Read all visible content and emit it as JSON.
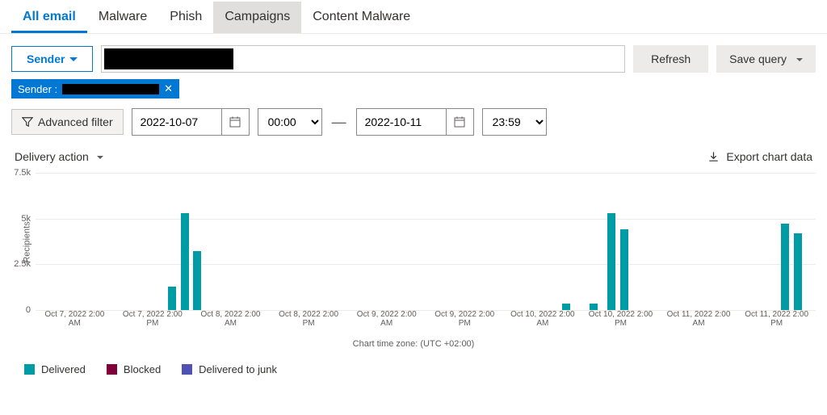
{
  "tabs": [
    "All email",
    "Malware",
    "Phish",
    "Campaigns",
    "Content Malware"
  ],
  "active_tab": 0,
  "muted_tab": 3,
  "filter": {
    "sender_label": "Sender",
    "search_value": "",
    "refresh_label": "Refresh",
    "save_query_label": "Save query"
  },
  "chip": {
    "label": "Sender :",
    "remove": "✕"
  },
  "adv_filter_label": "Advanced filter",
  "date": {
    "start": "2022-10-07",
    "start_time": "00:00",
    "end": "2022-10-11",
    "end_time": "23:59"
  },
  "view_label": "Delivery action",
  "export_label": "Export chart data",
  "chart_data": {
    "type": "bar",
    "ylabel": "Recipients",
    "ylim": [
      0,
      7500
    ],
    "yticks": [
      0,
      2500,
      5000,
      7500
    ],
    "ytick_labels": [
      "0",
      "2.5k",
      "5k",
      "7.5k"
    ],
    "xticks": [
      "Oct 7, 2022 2:00\nAM",
      "Oct 7, 2022 2:00\nPM",
      "Oct 8, 2022 2:00\nAM",
      "Oct 8, 2022 2:00\nPM",
      "Oct 9, 2022 2:00\nAM",
      "Oct 9, 2022 2:00\nPM",
      "Oct 10, 2022 2:00\nAM",
      "Oct 10, 2022 2:00\nPM",
      "Oct 11, 2022 2:00\nAM",
      "Oct 11, 2022 2:00\nPM"
    ],
    "series": [
      {
        "name": "Delivered",
        "color": "#009ca6",
        "bars": [
          {
            "x_pct": 17.0,
            "value": 1300
          },
          {
            "x_pct": 18.6,
            "value": 5300
          },
          {
            "x_pct": 20.2,
            "value": 3200
          },
          {
            "x_pct": 67.5,
            "value": 350
          },
          {
            "x_pct": 71.0,
            "value": 350
          },
          {
            "x_pct": 73.3,
            "value": 5300
          },
          {
            "x_pct": 74.9,
            "value": 4400
          },
          {
            "x_pct": 95.6,
            "value": 4700
          },
          {
            "x_pct": 97.2,
            "value": 4200
          }
        ]
      },
      {
        "name": "Blocked",
        "color": "#80003a",
        "bars": []
      },
      {
        "name": "Delivered to junk",
        "color": "#4f52b2",
        "bars": []
      }
    ],
    "timezone_label": "Chart time zone: (UTC +02:00)"
  },
  "legend": [
    {
      "label": "Delivered",
      "color": "#009ca6"
    },
    {
      "label": "Blocked",
      "color": "#80003a"
    },
    {
      "label": "Delivered to junk",
      "color": "#4f52b2"
    }
  ]
}
